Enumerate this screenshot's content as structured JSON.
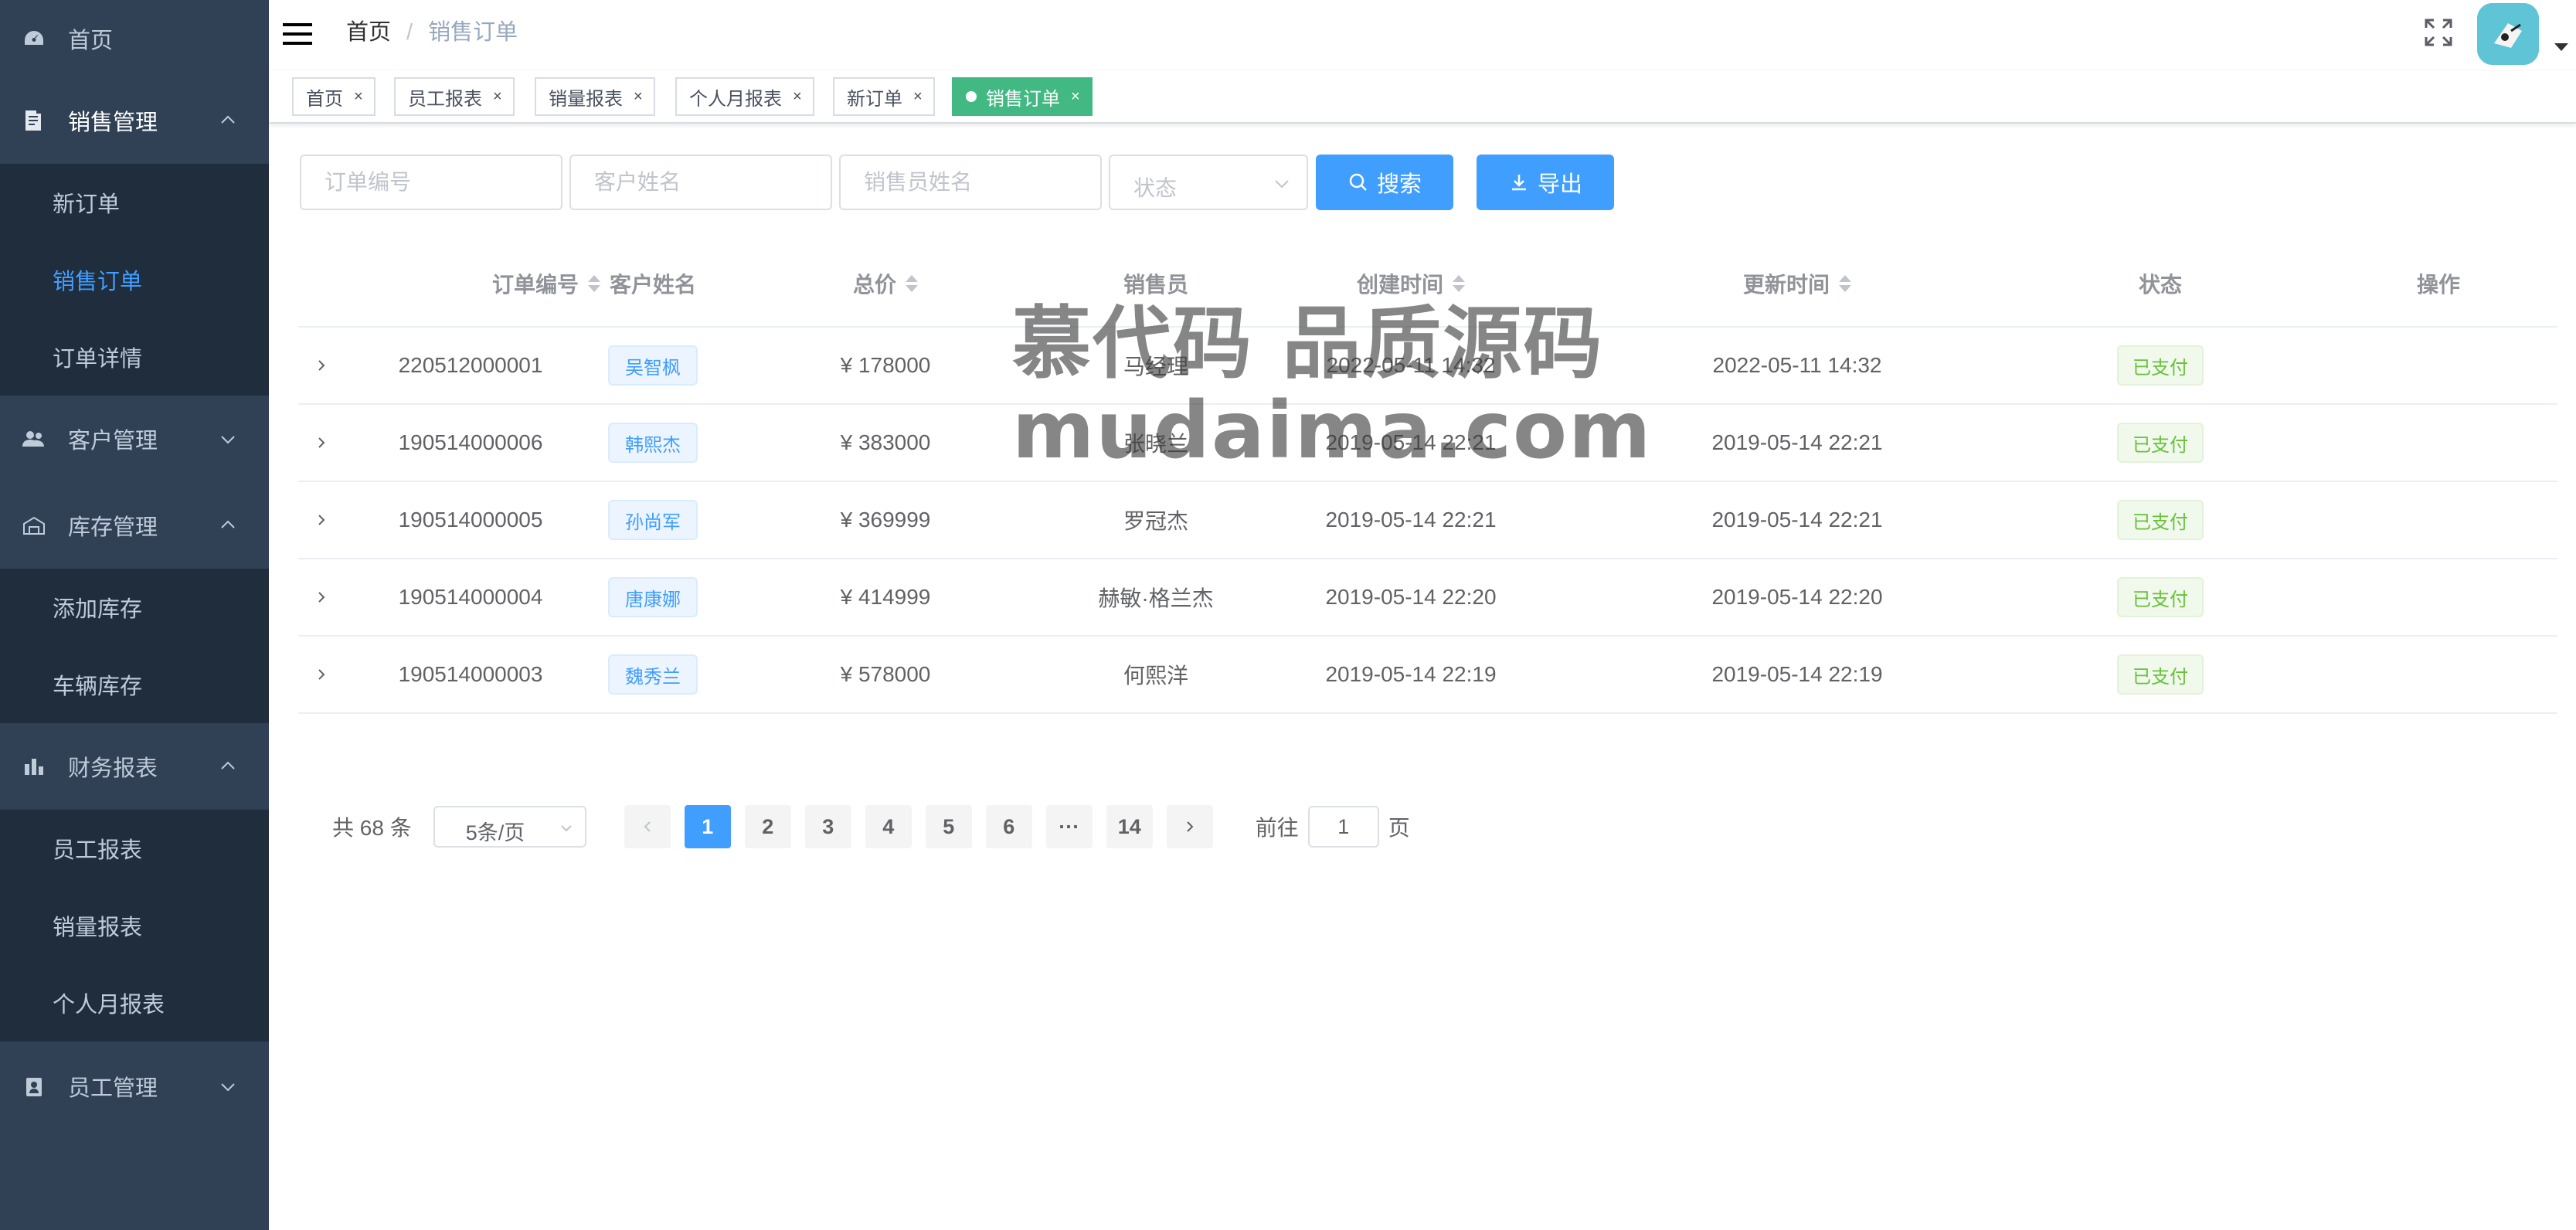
{
  "sidebar": {
    "home": "首页",
    "groups": [
      {
        "label": "销售管理",
        "items": [
          "新订单",
          "销售订单",
          "订单详情"
        ]
      },
      {
        "label": "客户管理"
      },
      {
        "label": "库存管理",
        "items": [
          "添加库存",
          "车辆库存"
        ]
      },
      {
        "label": "财务报表",
        "items": [
          "员工报表",
          "销量报表",
          "个人月报表"
        ]
      },
      {
        "label": "员工管理"
      }
    ]
  },
  "breadcrumb": {
    "home": "首页",
    "separator": "/",
    "current": "销售订单"
  },
  "tags": [
    "首页",
    "员工报表",
    "销量报表",
    "个人月报表",
    "新订单",
    "销售订单"
  ],
  "filters": {
    "order_no": "订单编号",
    "customer_name": "客户姓名",
    "salesperson_name": "销售员姓名",
    "status": "状态",
    "search_label": "搜索",
    "export_label": "导出"
  },
  "table": {
    "headers": [
      "订单编号",
      "客户姓名",
      "总价",
      "销售员",
      "创建时间",
      "更新时间",
      "状态",
      "操作"
    ],
    "rows": [
      {
        "order_no": "220512000001",
        "customer": "吴智枫",
        "price": "¥ 178000",
        "salesperson": "马经理",
        "created": "2022-05-11 14:32",
        "updated": "2022-05-11 14:32",
        "status": "已支付"
      },
      {
        "order_no": "190514000006",
        "customer": "韩熙杰",
        "price": "¥ 383000",
        "salesperson": "张晓兰",
        "created": "2019-05-14 22:21",
        "updated": "2019-05-14 22:21",
        "status": "已支付"
      },
      {
        "order_no": "190514000005",
        "customer": "孙尚军",
        "price": "¥ 369999",
        "salesperson": "罗冠杰",
        "created": "2019-05-14 22:21",
        "updated": "2019-05-14 22:21",
        "status": "已支付"
      },
      {
        "order_no": "190514000004",
        "customer": "唐康娜",
        "price": "¥ 414999",
        "salesperson": "赫敏·格兰杰",
        "created": "2019-05-14 22:20",
        "updated": "2019-05-14 22:20",
        "status": "已支付"
      },
      {
        "order_no": "190514000003",
        "customer": "魏秀兰",
        "price": "¥ 578000",
        "salesperson": "何熙洋",
        "created": "2019-05-14 22:19",
        "updated": "2019-05-14 22:19",
        "status": "已支付"
      }
    ]
  },
  "pagination": {
    "total": "共 68 条",
    "page_size": "5条/页",
    "pages": [
      "1",
      "2",
      "3",
      "4",
      "5",
      "6",
      "···",
      "14"
    ],
    "current": "1",
    "goto_label": "前往",
    "goto_value": "1",
    "page_unit": "页"
  },
  "watermark": {
    "line1": "慕代码 品质源码",
    "line2": "mudaima.com"
  },
  "colors": {
    "sidebar": "#304156",
    "submenu": "#1f2d3d",
    "primary": "#409eff",
    "active_tag": "#42b983",
    "success": "#67c23a"
  }
}
